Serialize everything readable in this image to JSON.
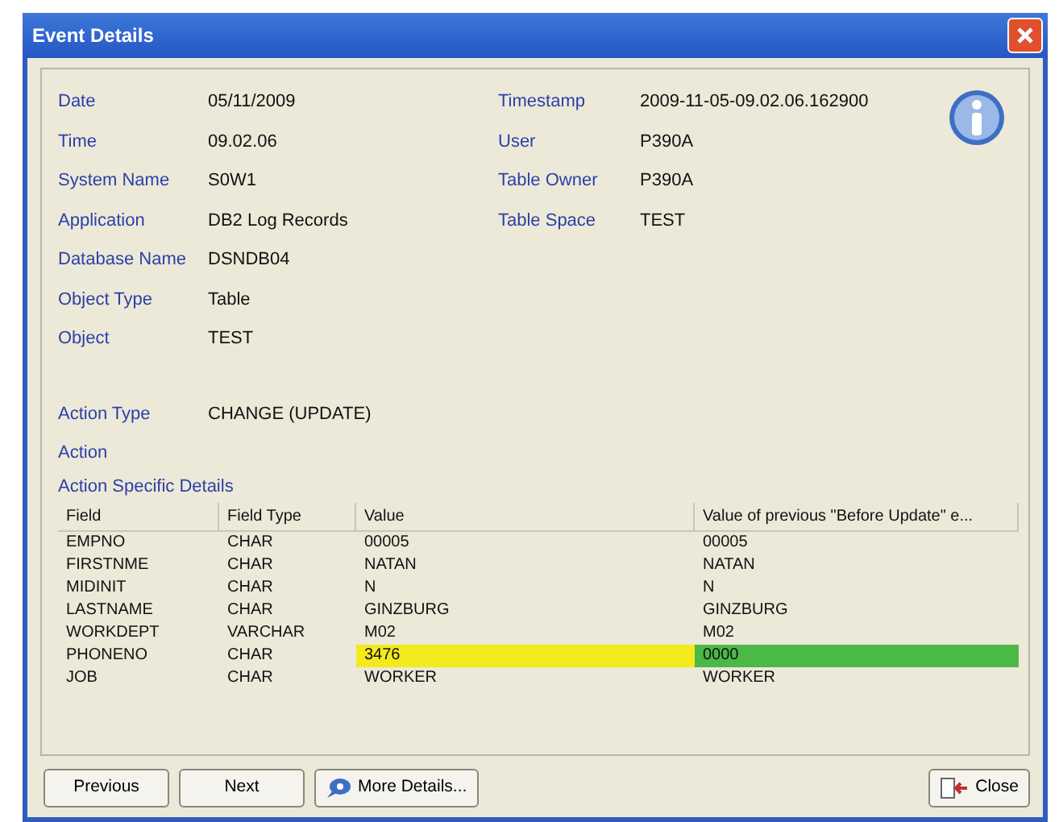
{
  "window": {
    "title": "Event Details"
  },
  "details_left": [
    {
      "label": "Date",
      "value": "05/11/2009"
    },
    {
      "label": "Time",
      "value": "09.02.06"
    },
    {
      "label": "System Name",
      "value": "S0W1"
    },
    {
      "label": "Application",
      "value": "DB2 Log Records"
    },
    {
      "label": "Database Name",
      "value": "DSNDB04"
    },
    {
      "label": "Object Type",
      "value": "Table"
    },
    {
      "label": "Object",
      "value": "TEST"
    }
  ],
  "details_right": [
    {
      "label": "Timestamp",
      "value": "2009-11-05-09.02.06.162900"
    },
    {
      "label": "User",
      "value": "P390A"
    },
    {
      "label": "Table Owner",
      "value": "P390A"
    },
    {
      "label": "Table Space",
      "value": "TEST"
    }
  ],
  "action": [
    {
      "label": "Action Type",
      "value": "CHANGE (UPDATE)"
    },
    {
      "label": "Action"
    }
  ],
  "table": {
    "title": "Action Specific Details",
    "columns": [
      "Field",
      "Field Type",
      "Value",
      "Value of previous \"Before Update\" e..."
    ],
    "rows": [
      {
        "cells": [
          "EMPNO",
          "CHAR",
          "00005",
          "00005"
        ],
        "changed": false
      },
      {
        "cells": [
          "FIRSTNME",
          "CHAR",
          "NATAN",
          "NATAN"
        ],
        "changed": false
      },
      {
        "cells": [
          "MIDINIT",
          "CHAR",
          "N",
          "N"
        ],
        "changed": false
      },
      {
        "cells": [
          "LASTNAME",
          "CHAR",
          "GINZBURG",
          "GINZBURG"
        ],
        "changed": false
      },
      {
        "cells": [
          "WORKDEPT",
          "VARCHAR",
          "M02",
          "M02"
        ],
        "changed": false
      },
      {
        "cells": [
          "PHONENO",
          "CHAR",
          "3476",
          "0000"
        ],
        "changed": true
      },
      {
        "cells": [
          "JOB",
          "CHAR",
          "WORKER",
          "WORKER"
        ],
        "changed": false
      }
    ]
  },
  "buttons": [
    {
      "label": "Previous",
      "kind": "plain"
    },
    {
      "label": "Next",
      "kind": "plain"
    },
    {
      "label": "More Details...",
      "kind": "details"
    },
    {
      "label": "Close",
      "kind": "close"
    }
  ]
}
